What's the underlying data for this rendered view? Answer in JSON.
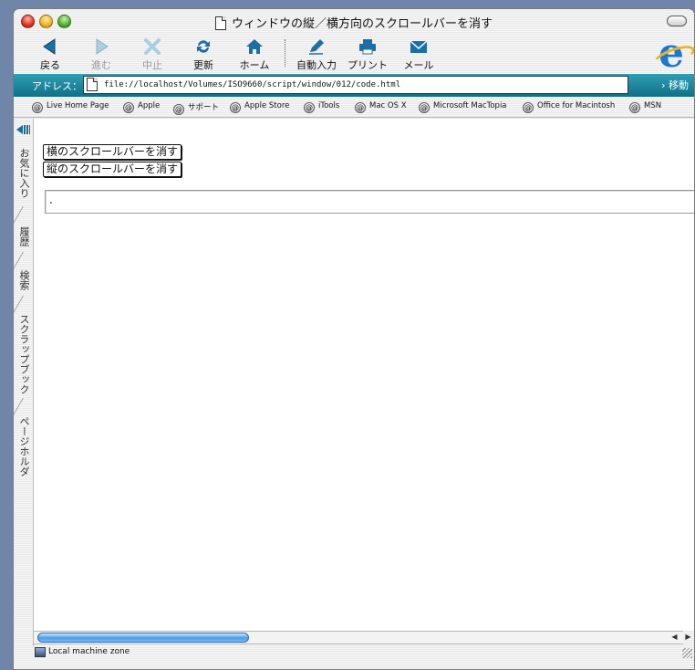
{
  "window": {
    "title": "ウィンドウの縦／横方向のスクロールバーを消す"
  },
  "toolbar": {
    "back": "戻る",
    "forward": "進む",
    "stop": "中止",
    "refresh": "更新",
    "home": "ホーム",
    "autofill": "自動入力",
    "print": "プリント",
    "mail": "メール"
  },
  "address": {
    "label": "アドレス：",
    "url": "file://localhost/Volumes/ISO9660/script/window/012/code.html",
    "go": "› 移動"
  },
  "favorites": [
    "Live Home Page",
    "Apple",
    "サポート",
    "Apple Store",
    "iTools",
    "Mac OS X",
    "Microsoft MacTopia",
    "Office for Macintosh",
    "MSN"
  ],
  "side_tabs": [
    "お気に入り",
    "履歴",
    "検索",
    "スクラップブック",
    "ページホルダ"
  ],
  "content": {
    "hide_horizontal_button": "横のスクロールバーを消す",
    "hide_vertical_button": "縦のスクロールバーを消す",
    "output_text": "."
  },
  "status": {
    "zone": "Local machine zone"
  },
  "colors": {
    "address_bar": "#0f7087",
    "accent_blue": "#1b78d1",
    "scroll_thumb": "#4a9ce8"
  }
}
